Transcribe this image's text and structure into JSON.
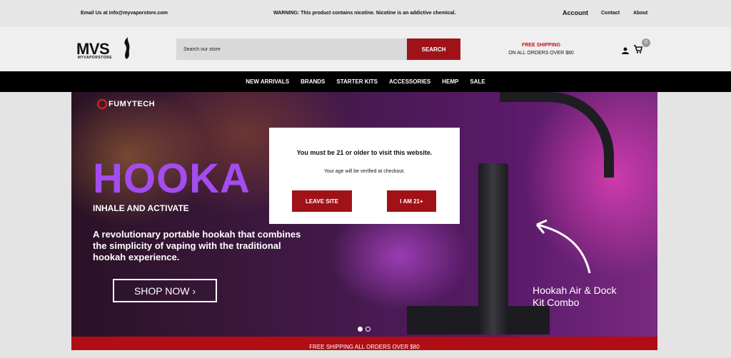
{
  "topbar": {
    "email": "Email Us at info@myvaporstore.com",
    "warning": "WARNING: This product contains nicotine. Nicotine is an addictive chemical.",
    "account": "Account",
    "contact": "Contact",
    "about": "About"
  },
  "header": {
    "logo_main": "MVS",
    "logo_sub": "MYVAPORSTORE",
    "search_placeholder": "Search our store",
    "search_button": "SEARCH",
    "shipping_title": "FREE SHIPPING",
    "shipping_sub": "ON ALL ORDERS OVER $80",
    "cart_count": "0"
  },
  "nav": {
    "items": [
      "NEW ARRIVALS",
      "BRANDS",
      "STARTER KITS",
      "ACCESSORIES",
      "HEMP",
      "SALE"
    ]
  },
  "hero": {
    "brand": "FUMYTECH",
    "headline": "HOOKA",
    "tagline": "INHALE AND ACTIVATE",
    "description": "A revolutionary portable hookah that combines the simplicity of vaping with the traditional hookah experience.",
    "cta": "SHOP NOW  ›",
    "product_line1": "Hookah Air & Dock",
    "product_line2": "Kit Combo"
  },
  "footbar": {
    "text": "FREE SHIPPING ALL ORDERS OVER $80"
  },
  "modal": {
    "title": "You must be 21 or older to visit this website.",
    "subtitle": "Your age will be verified at checkout.",
    "leave_label": "LEAVE SITE",
    "agree_label": "I AM 21+"
  },
  "colors": {
    "accent_red": "#9f1219",
    "nav_bg": "#000000",
    "headline_purple": "#a34cf0"
  }
}
